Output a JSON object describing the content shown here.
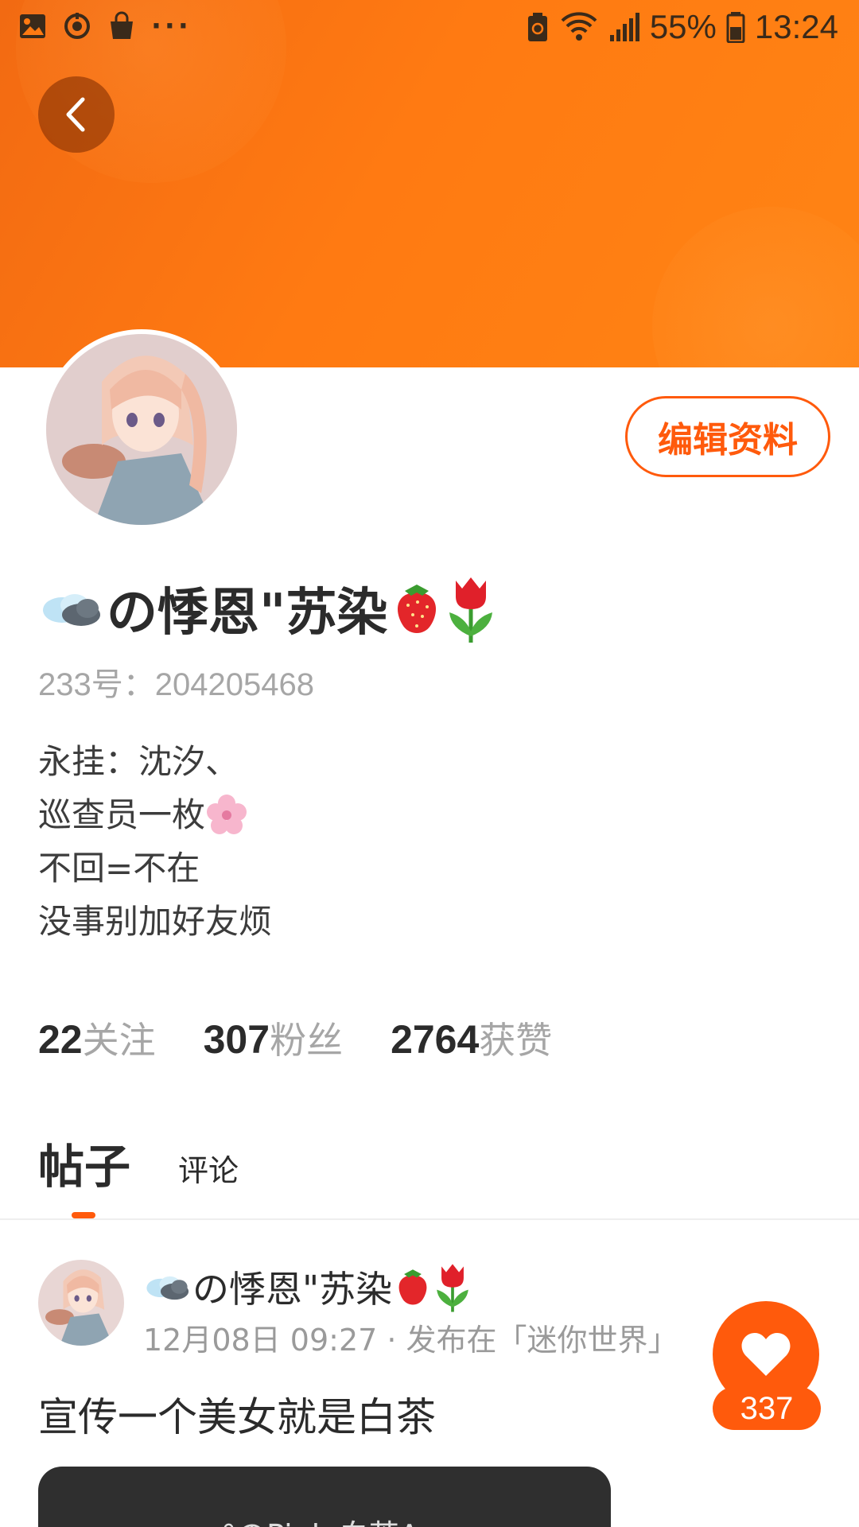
{
  "status_bar": {
    "battery": "55%",
    "time": "13:24",
    "left_icons": [
      "gallery-icon",
      "sync-icon",
      "shopping-bag-icon"
    ],
    "more": "···"
  },
  "profile": {
    "nickname": "の悸恩\"苏染",
    "uid": "233号：204205468",
    "edit_button": "编辑资料",
    "bio": [
      "永挂：沈汐、",
      "巡查员一枚",
      "不回=不在",
      "没事别加好友烦"
    ],
    "stats": [
      {
        "num": "22",
        "label": "关注"
      },
      {
        "num": "307",
        "label": "粉丝"
      },
      {
        "num": "2764",
        "label": "获赞"
      }
    ]
  },
  "tabs": {
    "posts": "帖子",
    "comments": "评论"
  },
  "post": {
    "author": "の悸恩\"苏染",
    "meta": "12月08日 09:27 · 发布在「迷你世界」",
    "title": "宣传一个美女就是白茶",
    "likes": "337",
    "image_caption": "°のPink 白茶A"
  },
  "colors": {
    "accent": "#ff5a0c",
    "banner": "#ff7a12"
  }
}
